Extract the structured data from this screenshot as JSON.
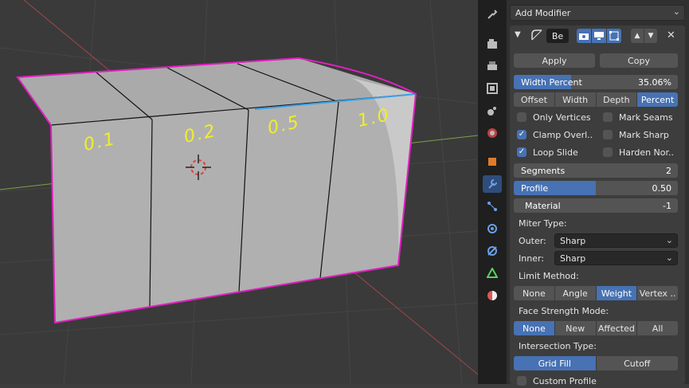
{
  "viewport": {
    "labels": [
      "0.1",
      "0.2",
      "0.5",
      "1.0"
    ]
  },
  "sidebar_tabs": [
    {
      "icon": "tool-icon"
    },
    {
      "icon": "render-icon"
    },
    {
      "icon": "output-icon"
    },
    {
      "icon": "view-layer-icon"
    },
    {
      "icon": "scene-icon"
    },
    {
      "icon": "world-icon"
    },
    {
      "icon": "object-icon"
    },
    {
      "icon": "modifier-wrench-icon"
    },
    {
      "icon": "particles-icon"
    },
    {
      "icon": "physics-icon"
    },
    {
      "icon": "constraints-icon"
    },
    {
      "icon": "data-icon"
    },
    {
      "icon": "material-icon"
    }
  ],
  "properties": {
    "add_modifier": "Add Modifier",
    "modifier_name": "Be",
    "apply": "Apply",
    "copy": "Copy",
    "width": {
      "label": "Width Percent",
      "value": "35.06%",
      "fraction": 0.3506
    },
    "width_type": {
      "options": [
        "Offset",
        "Width",
        "Depth",
        "Percent"
      ],
      "selected": "Percent"
    },
    "checks": [
      {
        "label": "Only Vertices",
        "checked": false
      },
      {
        "label": "Mark Seams",
        "checked": false
      },
      {
        "label": "Clamp Overl..",
        "checked": true
      },
      {
        "label": "Mark Sharp",
        "checked": false
      },
      {
        "label": "Loop Slide",
        "checked": true
      },
      {
        "label": "Harden Nor..",
        "checked": false
      }
    ],
    "segments": {
      "label": "Segments",
      "value": "2"
    },
    "profile": {
      "label": "Profile",
      "value": "0.50",
      "fraction": 0.5
    },
    "material": {
      "label": "Material",
      "value": "-1"
    },
    "miter_type": "Miter Type:",
    "outer": {
      "label": "Outer:",
      "value": "Sharp"
    },
    "inner": {
      "label": "Inner:",
      "value": "Sharp"
    },
    "limit_method": {
      "label": "Limit Method:",
      "options": [
        "None",
        "Angle",
        "Weight",
        "Vertex .."
      ],
      "selected": "Weight"
    },
    "face_strength": {
      "label": "Face Strength Mode:",
      "options": [
        "None",
        "New",
        "Affected",
        "All"
      ],
      "selected": "None"
    },
    "intersection": {
      "label": "Intersection Type:",
      "options": [
        "Grid Fill",
        "Cutoff"
      ],
      "selected": "Grid Fill"
    },
    "custom_profile": {
      "label": "Custom Profile",
      "checked": false
    }
  },
  "colors": {
    "accent": "#4772b3",
    "selection": "#e020c0",
    "label": "#f0ee2a"
  }
}
